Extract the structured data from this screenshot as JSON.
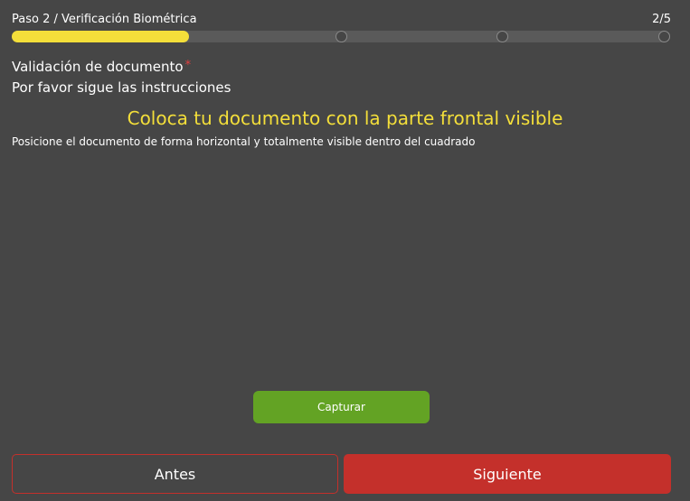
{
  "step": {
    "label": "Paso 2 / Verificación Biométrica",
    "count": "2/5",
    "progress_fraction": 0.25,
    "dots": [
      0.5,
      0.75,
      1.0
    ],
    "colors": {
      "fill": "#f4df3a",
      "track": "#5a5a5a"
    }
  },
  "field": {
    "label": "Validación de documento",
    "required_mark": "*",
    "instructions": "Por favor sigue las instrucciones"
  },
  "capture": {
    "title": "Coloca tu documento con la parte frontal visible",
    "subtitle": "Posicione el documento de forma horizontal y totalmente visible dentro del cuadrado",
    "button_label": "Capturar"
  },
  "nav": {
    "back_label": "Antes",
    "next_label": "Siguiente"
  },
  "colors": {
    "background": "#464646",
    "accent_yellow": "#f4df3a",
    "capture_green": "#63a324",
    "nav_red": "#c4302b"
  }
}
